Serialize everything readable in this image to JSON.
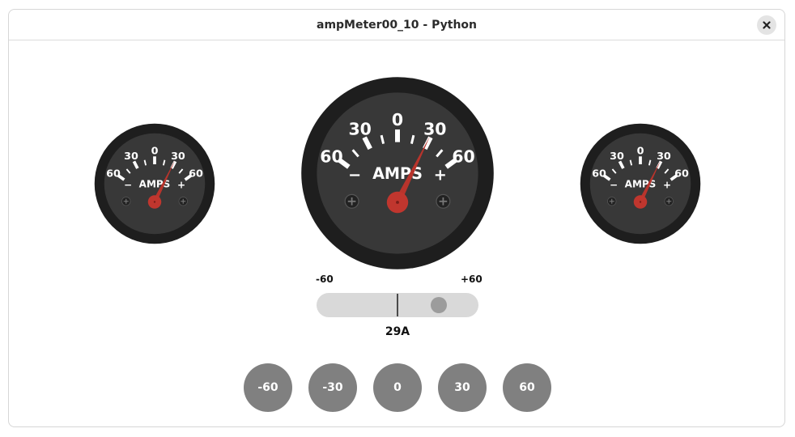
{
  "window": {
    "title": "ampMeter00_10 - Python"
  },
  "gauge": {
    "unit_label": "AMPS",
    "minus_sign": "−",
    "plus_sign": "+",
    "scale_labels": [
      "60",
      "30",
      "0",
      "30",
      "60"
    ],
    "min": -60,
    "max": 60,
    "value": 29
  },
  "control": {
    "min_label": "-60",
    "max_label": "+60",
    "value": 29,
    "readout": "29A"
  },
  "presets": [
    {
      "label": "-60",
      "value": -60
    },
    {
      "label": "-30",
      "value": -30
    },
    {
      "label": "0",
      "value": 0
    },
    {
      "label": "30",
      "value": 30
    },
    {
      "label": "60",
      "value": 60
    }
  ],
  "colors": {
    "bezel": "#1e1e1e",
    "dial": "#383838",
    "needle": "#b8342c",
    "hub": "#c0362e",
    "marking": "#ffffff",
    "preset_button": "#808080",
    "slider_track": "#d9d9d9"
  },
  "icons": {
    "close": "close-icon",
    "screw": "screw-icon"
  }
}
